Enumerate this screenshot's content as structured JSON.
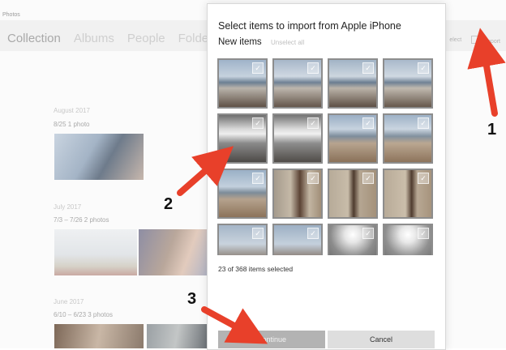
{
  "app": {
    "title": "Photos",
    "nav": [
      "Collection",
      "Albums",
      "People",
      "Folders"
    ],
    "tools": {
      "select_label": "elect",
      "import_label": "Import"
    }
  },
  "sections": [
    {
      "header": "August 2017",
      "sub": "8/25   1 photo"
    },
    {
      "header": "July 2017",
      "sub": "7/3 – 7/26   2 photos"
    },
    {
      "header": "June 2017",
      "sub": "6/10 – 6/23   3 photos"
    }
  ],
  "dialog": {
    "title": "Select items to import from Apple iPhone",
    "new_items": "New items",
    "unselect_all": "Unselect all",
    "selected_count": "23 of 368 items selected",
    "continue_label": "Continue",
    "cancel_label": "Cancel",
    "check_glyph": "✓"
  },
  "annotations": {
    "step1": "1",
    "step2": "2",
    "step3": "3",
    "arrow_color": "#e8402a"
  },
  "colors": {
    "accent_arrow": "#e8402a",
    "continue_bg": "#b3b3b3",
    "cancel_bg": "#dedede"
  }
}
